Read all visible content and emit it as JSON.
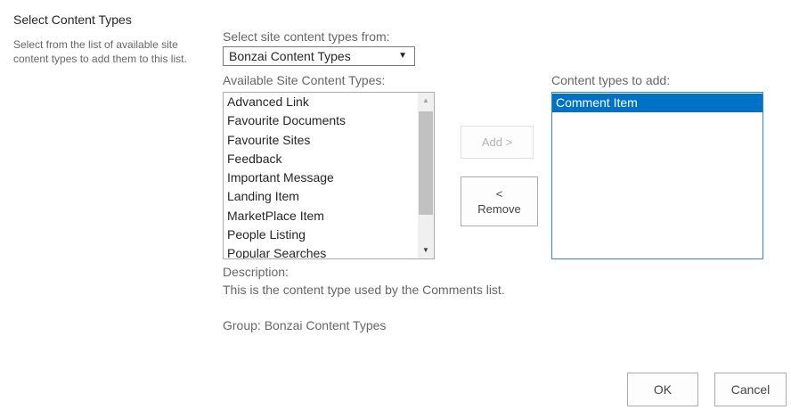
{
  "section": {
    "title": "Select Content Types",
    "description": "Select from the list of available site content types to add them to this list."
  },
  "source_select": {
    "label": "Select site content types from:",
    "value": "Bonzai Content Types",
    "arrow_icon": "dropdown-arrow-icon"
  },
  "available": {
    "label": "Available Site Content Types:",
    "items": [
      "Advanced Link",
      "Favourite Documents",
      "Favourite Sites",
      "Feedback",
      "Important Message",
      "Landing Item",
      "MarketPlace Item",
      "People Listing",
      "Popular Searches"
    ]
  },
  "buttons": {
    "add": "Add >",
    "remove_symbol": "<",
    "remove": "Remove",
    "ok": "OK",
    "cancel": "Cancel"
  },
  "to_add": {
    "label": "Content types to add:",
    "items": [
      "Comment Item"
    ],
    "selected_index": 0
  },
  "details": {
    "description_label": "Description:",
    "description_text": "This is the content type used by the Comments list.",
    "group_text": "Group: Bonzai Content Types"
  },
  "colors": {
    "selection": "#0072c6",
    "focus_border": "#2a8dd4"
  }
}
